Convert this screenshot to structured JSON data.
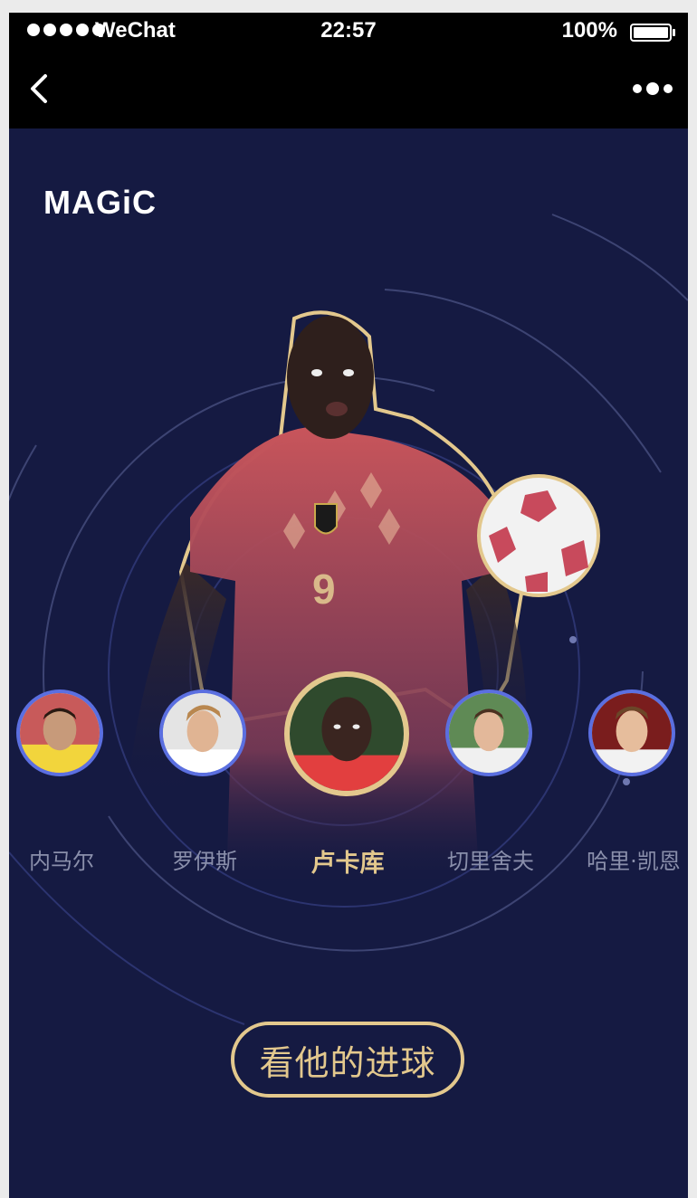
{
  "status_bar": {
    "carrier": "WeChat",
    "time": "22:57",
    "battery": "100%"
  },
  "nav": {
    "back_icon": "chevron-left-icon",
    "more_icon": "more-dots-icon"
  },
  "brand": {
    "logo_text": "MAGiC"
  },
  "players": [
    {
      "name": "内马尔",
      "active": false
    },
    {
      "name": "罗伊斯",
      "active": false
    },
    {
      "name": "卢卡库",
      "active": true
    },
    {
      "name": "切里舍夫",
      "active": false
    },
    {
      "name": "哈里·凯恩",
      "active": false
    }
  ],
  "cta": {
    "label": "看他的进球"
  },
  "colors": {
    "background": "#151a42",
    "accent_gold": "#e3c88d",
    "ring_blue": "#5b6fe0",
    "muted_text": "#8a8fab"
  }
}
